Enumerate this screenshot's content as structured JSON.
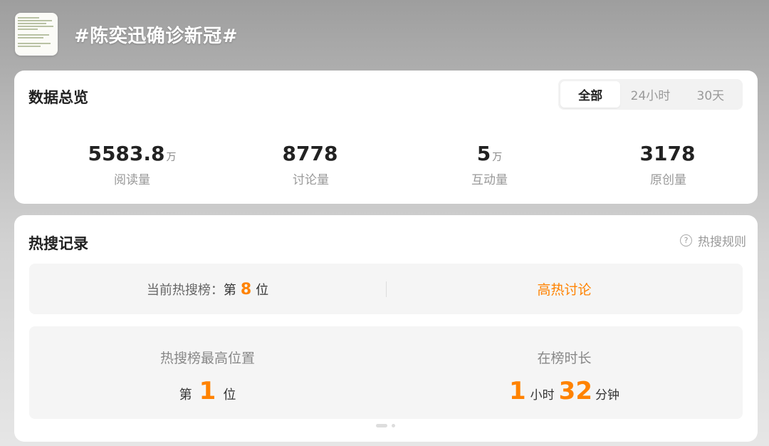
{
  "header": {
    "title": "#陈奕迅确诊新冠#",
    "thumbnail_icon": "topic-thumbnail"
  },
  "overview": {
    "title": "数据总览",
    "tabs": [
      {
        "label": "全部",
        "active": true
      },
      {
        "label": "24小时",
        "active": false
      },
      {
        "label": "30天",
        "active": false
      }
    ],
    "stats": [
      {
        "value": "5583.8",
        "unit": "万",
        "label": "阅读量"
      },
      {
        "value": "8778",
        "unit": "",
        "label": "讨论量"
      },
      {
        "value": "5",
        "unit": "万",
        "label": "互动量"
      },
      {
        "value": "3178",
        "unit": "",
        "label": "原创量"
      }
    ]
  },
  "hot_search": {
    "title": "热搜记录",
    "rules_label": "热搜规则",
    "help_icon_glyph": "?",
    "current_label": "当前热搜榜：",
    "current_prefix": "第",
    "current_rank": "8",
    "current_suffix": "位",
    "tag": "高热讨论",
    "peak_label": "热搜榜最高位置",
    "peak_prefix": "第",
    "peak_rank": "1",
    "peak_suffix": "位",
    "duration_label": "在榜时长",
    "duration_hours": "1",
    "duration_hours_unit": "小时",
    "duration_minutes": "32",
    "duration_minutes_unit": "分钟"
  },
  "colors": {
    "accent": "#ff8200",
    "card_bg": "#ffffff",
    "panel_bg": "#f5f5f5"
  }
}
